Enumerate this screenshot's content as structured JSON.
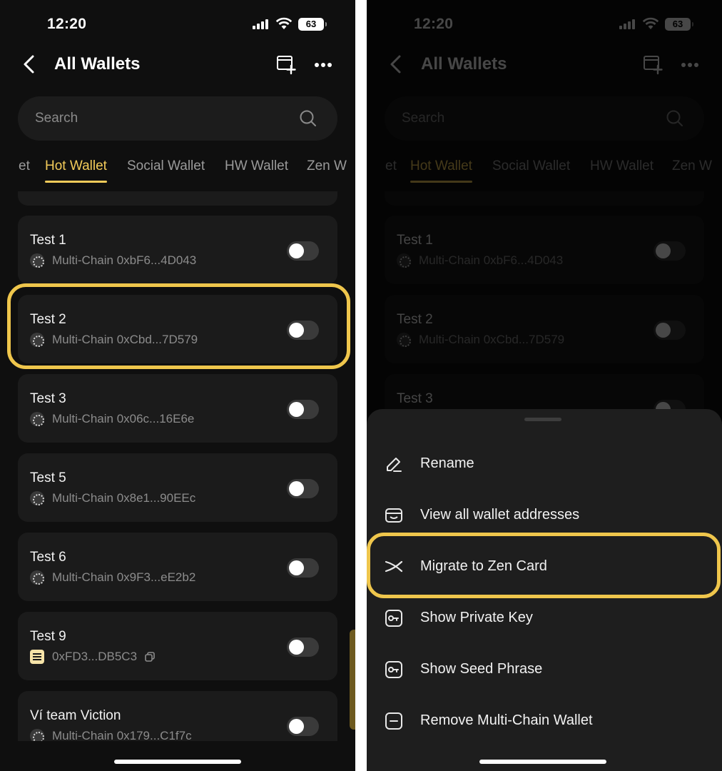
{
  "status": {
    "time": "12:20",
    "battery": "63"
  },
  "header": {
    "title": "All Wallets"
  },
  "search": {
    "placeholder": "Search"
  },
  "tabs": [
    "et",
    "Hot Wallet",
    "Social Wallet",
    "HW Wallet",
    "Zen W"
  ],
  "active_tab": "Hot Wallet",
  "wallets": [
    {
      "name": "Test 1",
      "address": "Multi-Chain 0xbF6...4D043",
      "icon": "multichain-icon"
    },
    {
      "name": "Test 2",
      "address": "Multi-Chain 0xCbd...7D579",
      "icon": "multichain-icon"
    },
    {
      "name": "Test 3",
      "address": "Multi-Chain 0x06c...16E6e",
      "icon": "multichain-icon"
    },
    {
      "name": "Test 5",
      "address": "Multi-Chain 0x8e1...90EEc",
      "icon": "multichain-icon"
    },
    {
      "name": "Test 6",
      "address": "Multi-Chain 0x9F3...eE2b2",
      "icon": "multichain-icon"
    },
    {
      "name": "Test 9",
      "address": "0xFD3...DB5C3",
      "icon": "card-icon"
    },
    {
      "name": "Ví team Viction",
      "address": "Multi-Chain 0x179...C1f7c",
      "icon": "multichain-icon"
    }
  ],
  "menu": [
    {
      "label": "Rename",
      "icon": "pencil-icon"
    },
    {
      "label": "View all wallet addresses",
      "icon": "wallet-icon"
    },
    {
      "label": "Migrate to Zen Card",
      "icon": "zen-icon"
    },
    {
      "label": "Show Private Key",
      "icon": "key-icon"
    },
    {
      "label": "Show Seed Phrase",
      "icon": "key-icon"
    },
    {
      "label": "Remove Multi-Chain Wallet",
      "icon": "minus-icon"
    }
  ],
  "colors": {
    "accent": "#f3cb5a",
    "highlight": "#efc64c",
    "background": "#0f0f0f",
    "card": "#1b1b1b"
  }
}
